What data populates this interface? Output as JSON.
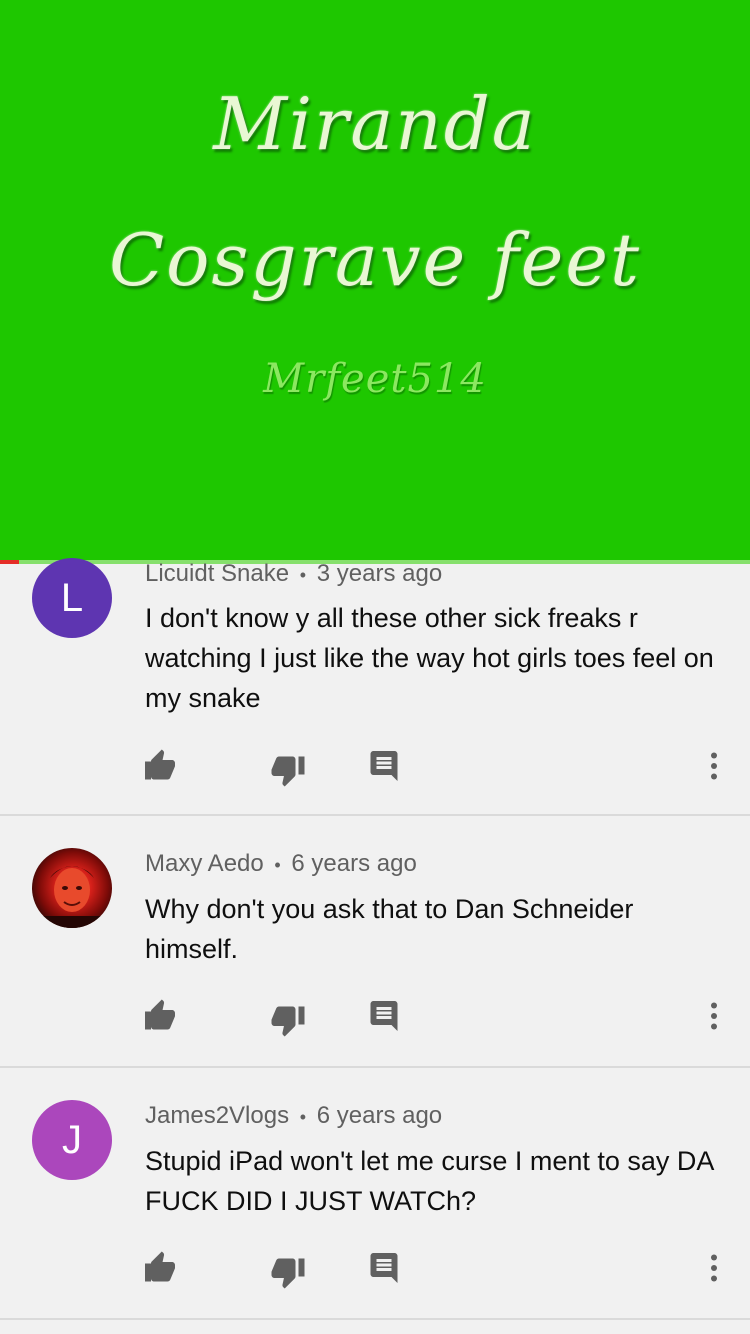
{
  "video": {
    "title_line1": "Miranda",
    "title_line2": "Cosgrave feet",
    "watermark": "Mrfeet514",
    "background_color": "#1ec700",
    "progress_fraction": 0.025
  },
  "comments": [
    {
      "author": "Licuidt Snake",
      "separator": "•",
      "time": "3 years ago",
      "text": "I don't know y all these other sick freaks r watching I just like the way hot girls toes feel on my snake",
      "avatar_letter": "L",
      "avatar_color": "#5e35b1"
    },
    {
      "author": "Maxy Aedo",
      "separator": "•",
      "time": "6 years ago",
      "text": "Why don't you ask that to Dan Schneider himself.",
      "avatar_letter": "",
      "avatar_color": "#c62828"
    },
    {
      "author": "James2Vlogs",
      "separator": "•",
      "time": "6 years ago",
      "text": "Stupid iPad won't let me curse I ment to say DA FUCK DID I JUST WATCh?",
      "avatar_letter": "J",
      "avatar_color": "#ab47bc"
    }
  ],
  "icons": {
    "like": "thumbs-up-icon",
    "dislike": "thumbs-down-icon",
    "reply": "comment-icon",
    "more": "more-vertical-icon"
  }
}
